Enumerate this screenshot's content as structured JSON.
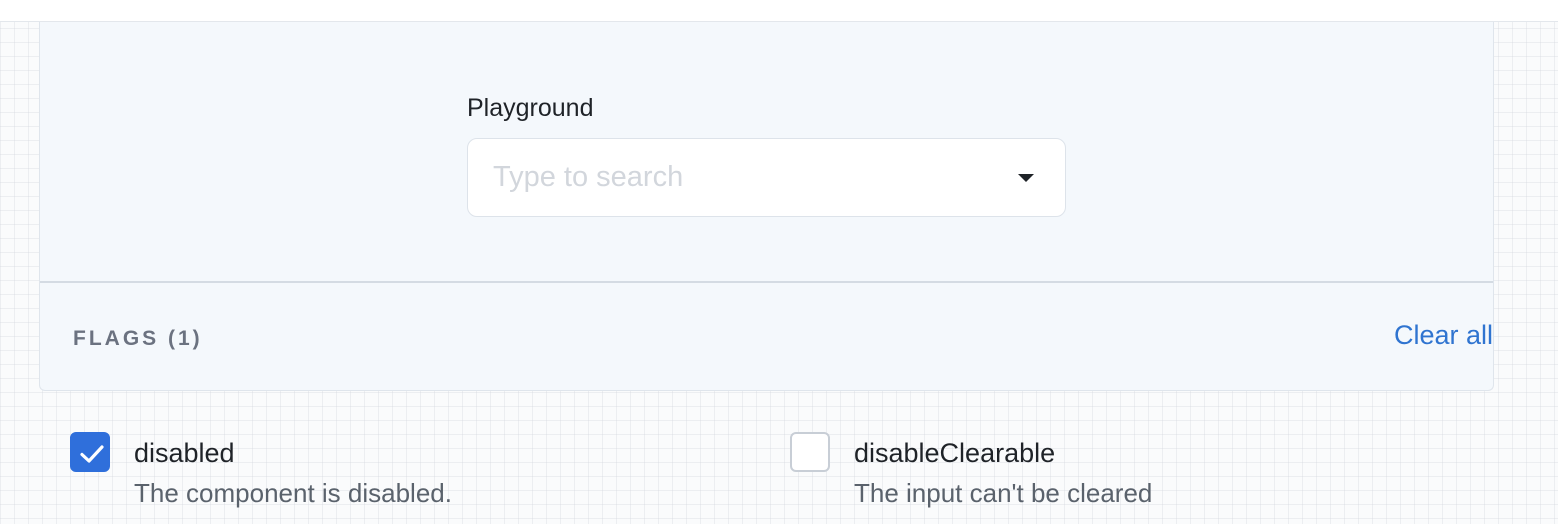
{
  "playground": {
    "label": "Playground",
    "select": {
      "value": "",
      "placeholder": "Type to search",
      "caret_icon": "caret-down-icon"
    }
  },
  "flags": {
    "title": "FLAGS (1)",
    "clear_all_label": "Clear all",
    "items": [
      {
        "name": "disabled",
        "description": "The component is disabled.",
        "checked": true,
        "icon": "checkmark-icon"
      },
      {
        "name": "disableClearable",
        "description": "The input can't be cleared",
        "checked": false
      }
    ]
  },
  "colors": {
    "accent": "#2f6fdb",
    "link": "#2f74d0",
    "panel_background": "#f4f8fc"
  }
}
